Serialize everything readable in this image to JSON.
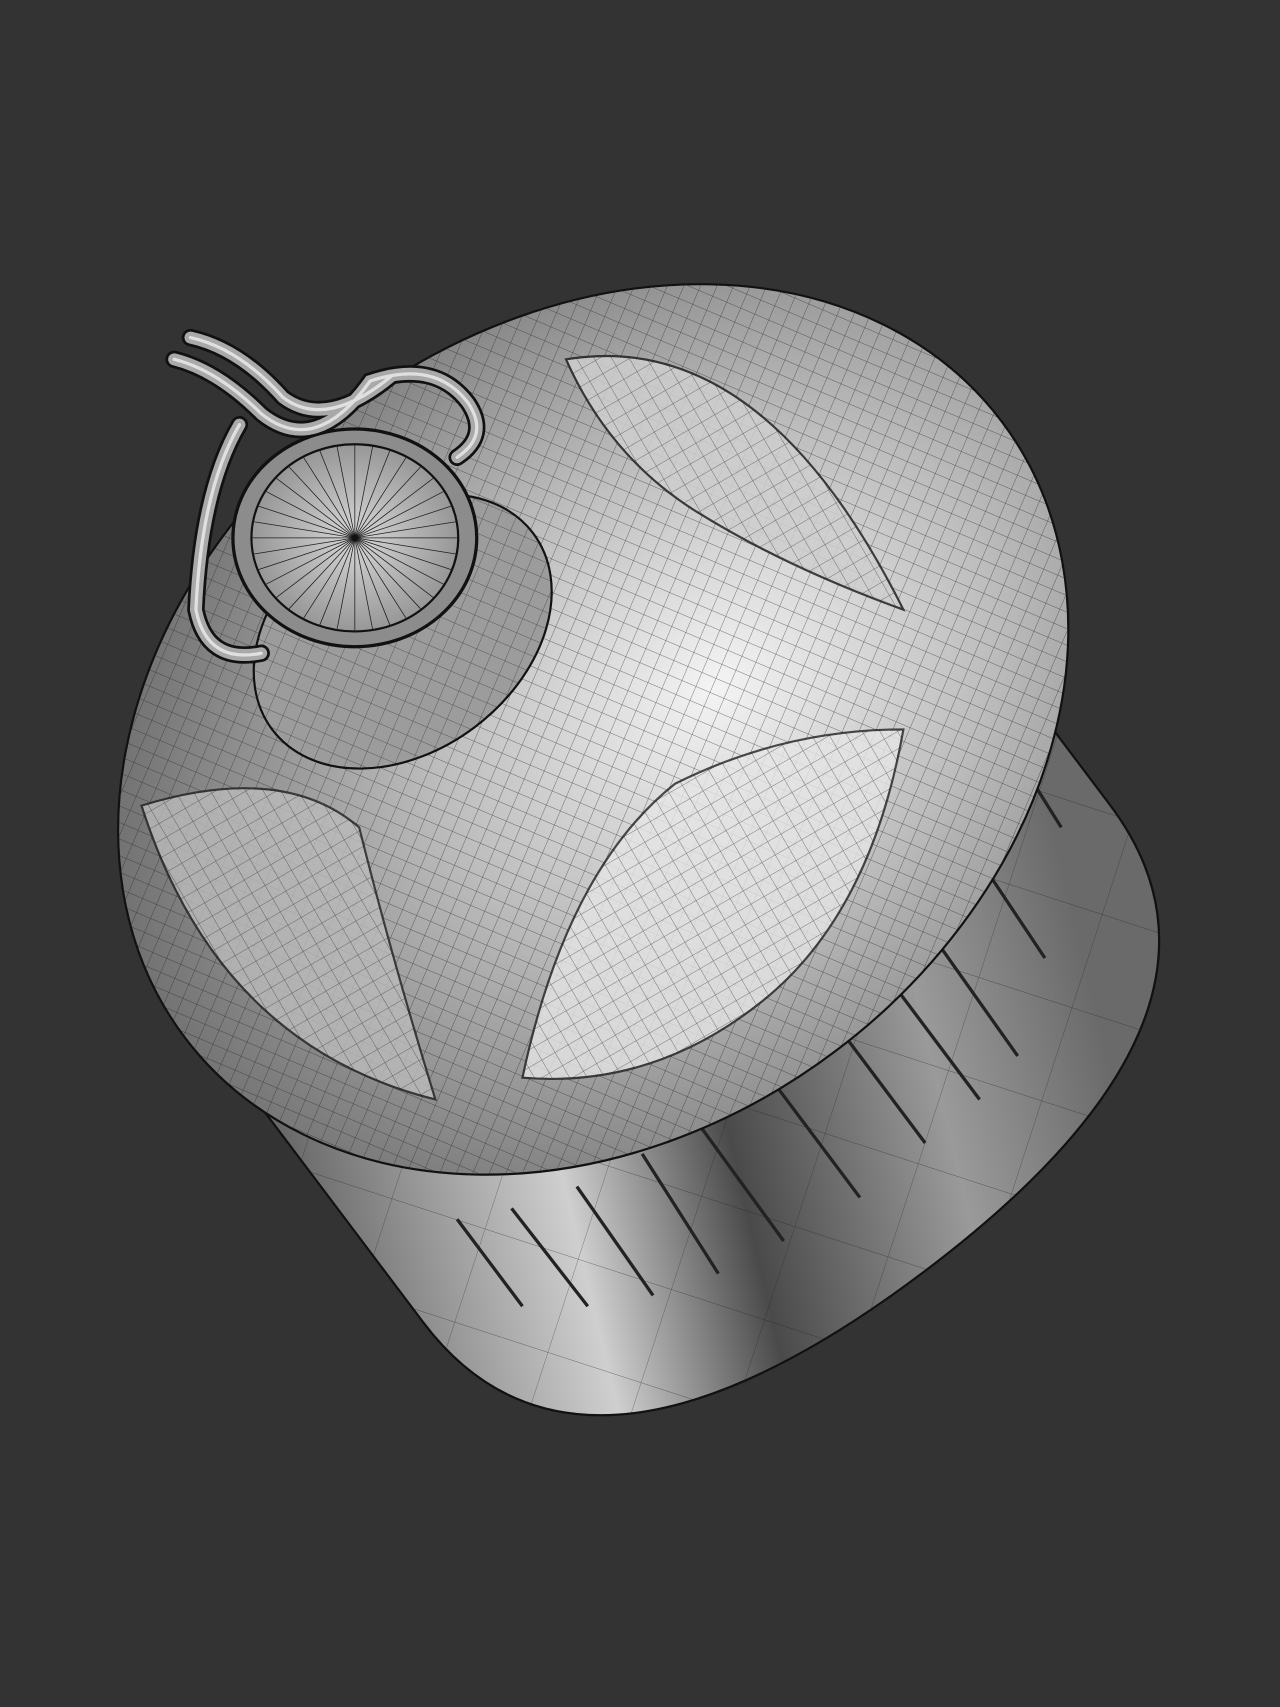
{
  "scene": {
    "background_color": "#333333",
    "model_base_color": "#a8a8a8",
    "wire_color": "#1e1e1e",
    "highlight_color": "#f2f2f2"
  }
}
